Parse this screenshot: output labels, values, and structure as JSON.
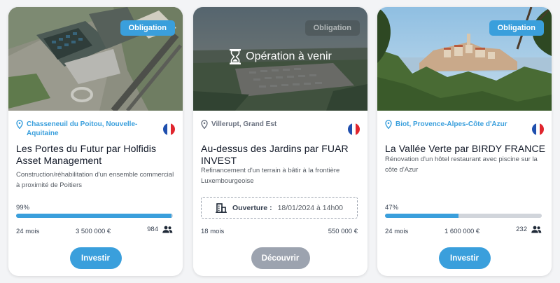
{
  "cards": [
    {
      "badge": "Obligation",
      "location": "Chasseneuil du Poitou, Nouvelle-Aquitaine",
      "title": "Les Portes du Futur par Holfidis Asset Management",
      "description": "Construction/réhabilitation d'un ensemble commercial à proximité de Poitiers",
      "progress_label": "99%",
      "progress": 0.99,
      "duration": "24 mois",
      "amount": "3 500 000 €",
      "investors": "984",
      "button": "Investir"
    },
    {
      "badge": "Obligation",
      "status": "Opération à venir",
      "location": "Villerupt, Grand Est",
      "title": "Au-dessus des Jardins par FUAR INVEST",
      "description": "Refinancement d'un terrain à bâtir à la frontière Luxembourgeoise",
      "opening_label": "Ouverture :",
      "opening_date": "18/01/2024 à 14h00",
      "duration": "18 mois",
      "amount": "550 000 €",
      "button": "Découvrir"
    },
    {
      "badge": "Obligation",
      "location": "Biot, Provence-Alpes-Côte d'Azur",
      "title": "La Vallée Verte par BIRDY FRANCE",
      "description": "Rénovation d'un hôtel restaurant avec piscine sur la côte d'Azur",
      "progress_label": "47%",
      "progress": 0.47,
      "duration": "24 mois",
      "amount": "1 600 000 €",
      "investors": "232",
      "button": "Investir"
    }
  ],
  "colors": {
    "accent": "#3a9fdc",
    "disabled": "#9ca3af",
    "flag": [
      "#1f4fae",
      "#ffffff",
      "#e0262e"
    ]
  }
}
